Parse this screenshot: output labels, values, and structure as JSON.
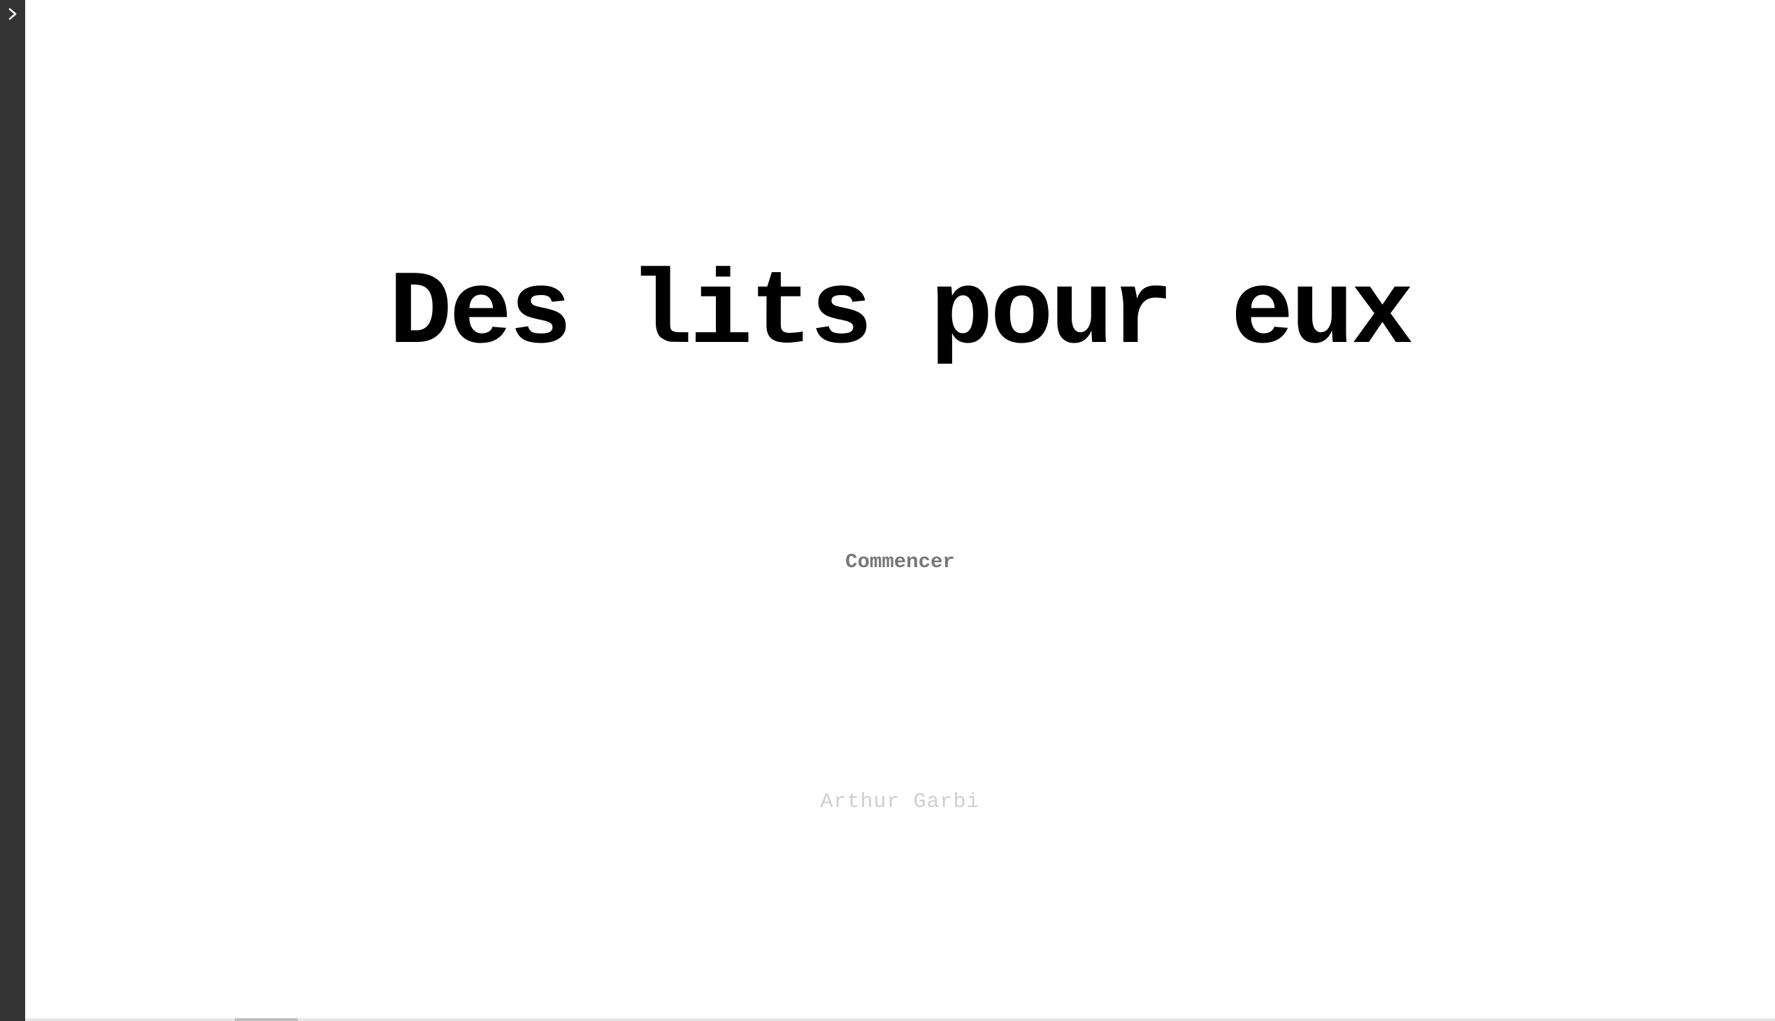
{
  "sidebar": {
    "toggle_icon": "chevron-right-icon"
  },
  "story": {
    "title": "Des lits pour eux",
    "start_label": "Commencer",
    "author": "Arthur Garbi"
  },
  "colors": {
    "sidebar_bg": "#333333",
    "title": "#000000",
    "start_link": "#777777",
    "author": "#cfcfcf"
  }
}
